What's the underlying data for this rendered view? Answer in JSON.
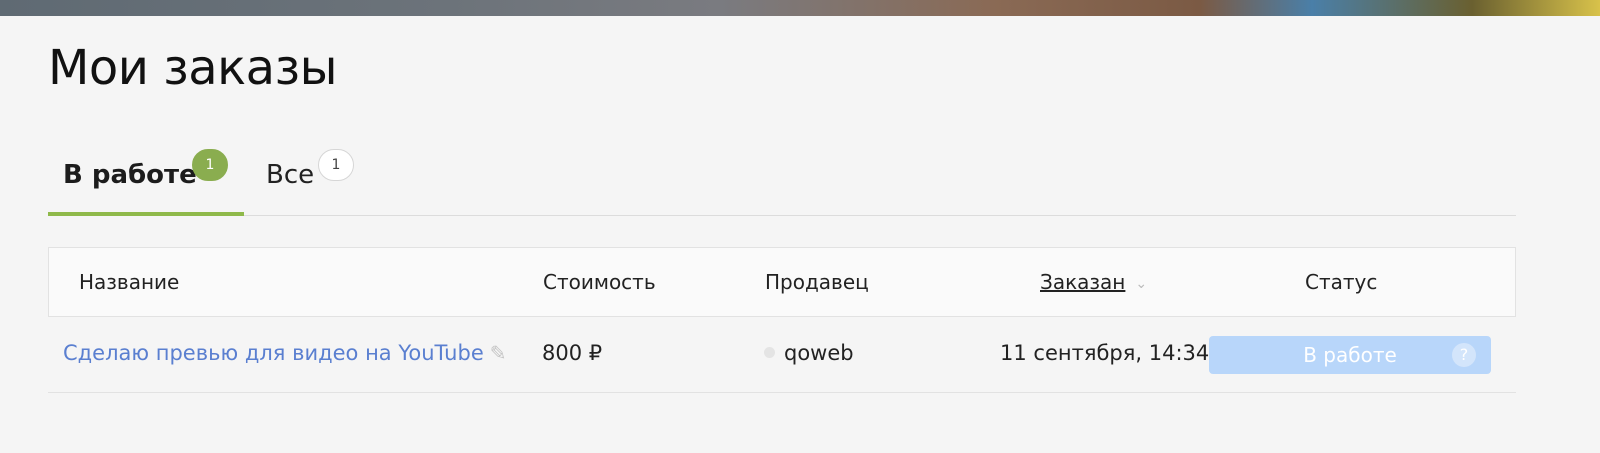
{
  "page": {
    "title": "Мои заказы"
  },
  "tabs": [
    {
      "label": "В работе",
      "count": "1",
      "active": true
    },
    {
      "label": "Все",
      "count": "1",
      "active": false
    }
  ],
  "table": {
    "columns": {
      "name": "Название",
      "cost": "Стоимость",
      "seller": "Продавец",
      "ordered": "Заказан",
      "status": "Статус"
    },
    "rows": [
      {
        "name": "Сделаю превью для видео на YouTube",
        "cost": "800 ₽",
        "seller": "qoweb",
        "ordered": "11 сентября, 14:34",
        "status": "В работе"
      }
    ]
  },
  "icons": {
    "edit": "pencil-icon",
    "sort": "chevron-down-icon",
    "help": "question-icon",
    "seller_status": "status-dot-icon"
  },
  "colors": {
    "accent_green": "#8fb94a",
    "link_blue": "#5a7fd0",
    "status_blue": "#b8d6fa",
    "background": "#f5f5f5"
  }
}
